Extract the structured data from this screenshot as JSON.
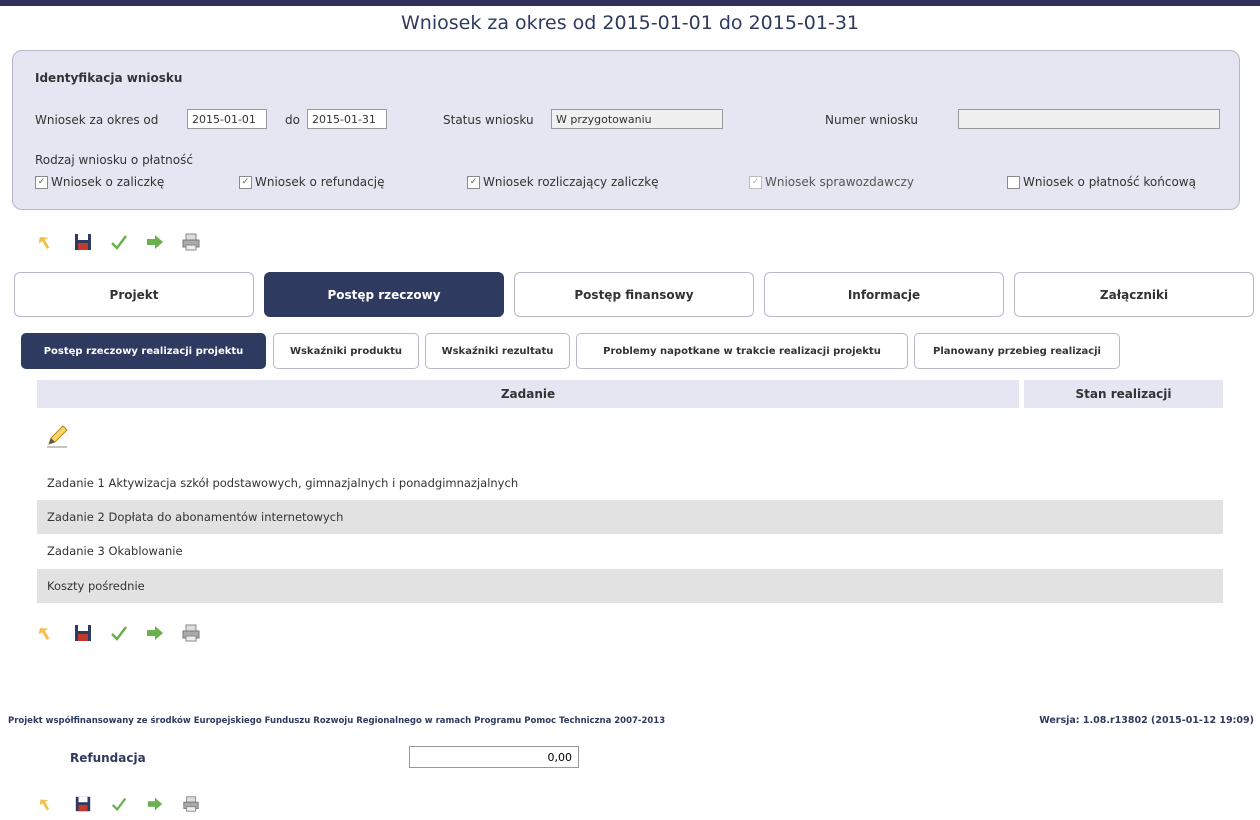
{
  "page_title": "Wniosek za okres od 2015-01-01 do 2015-01-31",
  "ident": {
    "heading": "Identyfikacja wniosku",
    "period_from_label": "Wniosek za okres od",
    "period_from_value": "2015-01-01",
    "period_to_label": "do",
    "period_to_value": "2015-01-31",
    "status_label": "Status wniosku",
    "status_value": "W przygotowaniu",
    "number_label": "Numer wniosku",
    "number_value": "",
    "type_label": "Rodzaj wniosku o płatność",
    "types": [
      {
        "label": "Wniosek o zaliczkę",
        "checked": true,
        "disabled": false
      },
      {
        "label": "Wniosek o refundację",
        "checked": true,
        "disabled": false
      },
      {
        "label": "Wniosek rozliczający zaliczkę",
        "checked": true,
        "disabled": false
      },
      {
        "label": "Wniosek sprawozdawczy",
        "checked": true,
        "disabled": true
      },
      {
        "label": "Wniosek o płatność końcową",
        "checked": false,
        "disabled": false
      }
    ]
  },
  "toolbar_icons": [
    "undo-icon",
    "save-icon",
    "check-icon",
    "forward-icon",
    "print-icon"
  ],
  "main_tabs": [
    {
      "label": "Projekt",
      "active": false
    },
    {
      "label": "Postęp rzeczowy",
      "active": true
    },
    {
      "label": "Postęp finansowy",
      "active": false
    },
    {
      "label": "Informacje",
      "active": false
    },
    {
      "label": "Załączniki",
      "active": false
    }
  ],
  "sub_tabs": [
    {
      "label": "Postęp rzeczowy realizacji projektu",
      "active": true
    },
    {
      "label": "Wskaźniki produktu",
      "active": false
    },
    {
      "label": "Wskaźniki rezultatu",
      "active": false
    },
    {
      "label": "Problemy napotkane w trakcie realizacji projektu",
      "active": false
    },
    {
      "label": "Planowany przebieg realizacji",
      "active": false
    }
  ],
  "table": {
    "headers": [
      "Zadanie",
      "Stan realizacji"
    ],
    "rows": [
      {
        "zadanie": "Zadanie 1 Aktywizacja szkół podstawowych, gimnazjalnych i ponadgimnazjalnych",
        "stan": ""
      },
      {
        "zadanie": "Zadanie 2 Dopłata do abonamentów internetowych",
        "stan": ""
      },
      {
        "zadanie": "Zadanie 3 Okablowanie",
        "stan": ""
      },
      {
        "zadanie": "Koszty pośrednie",
        "stan": ""
      }
    ]
  },
  "footer": {
    "left": "Projekt współfinansowany ze środków Europejskiego Funduszu Rozwoju Regionalnego w ramach Programu Pomoc Techniczna 2007-2013",
    "right": "Wersja: 1.08.r13802 (2015-01-12 19:09)"
  },
  "refundacja": {
    "label": "Refundacja",
    "value": "0,00"
  },
  "colors": {
    "accent": "#2e3a60",
    "panel": "#e6e6f3",
    "row_alt": "#e2e2e2"
  }
}
